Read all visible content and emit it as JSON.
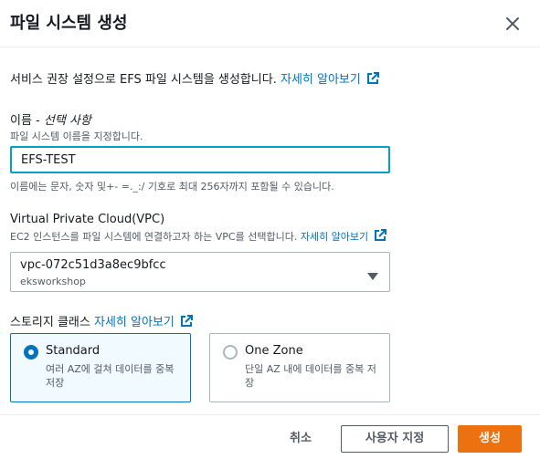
{
  "dialog": {
    "title": "파일 시스템 생성"
  },
  "intro": {
    "text": "서비스 권장 설정으로 EFS 파일 시스템을 생성합니다.",
    "link": "자세히 알아보기"
  },
  "name_field": {
    "label": "이름 - ",
    "optional": "선택 사항",
    "description": "파일 시스템 이름을 지정합니다.",
    "value": "EFS-TEST",
    "constraint": "이름에는 문자, 숫자 및+- =._:/ 기호로 최대 256자까지 포함될 수 있습니다."
  },
  "vpc_field": {
    "label": "Virtual Private Cloud(VPC)",
    "description": "EC2 인스턴스를 파일 시스템에 연결하고자 하는 VPC를 선택합니다.",
    "link": "자세히 알아보기",
    "selected_value": "vpc-072c51d3a8ec9bfcc",
    "selected_sub": "eksworkshop"
  },
  "storage_class": {
    "label": "스토리지 클래스",
    "link": "자세히 알아보기",
    "options": [
      {
        "title": "Standard",
        "description": "여러 AZ에 걸쳐 데이터를 중복 저장",
        "selected": true
      },
      {
        "title": "One Zone",
        "description": "단일 AZ 내에 데이터를 중복 저장",
        "selected": false
      }
    ]
  },
  "footer": {
    "cancel_label": "취소",
    "customize_label": "사용자 지정",
    "create_label": "생성"
  },
  "colors": {
    "link": "#0073bb",
    "primary": "#ec7211",
    "focus": "#00a1c9"
  }
}
